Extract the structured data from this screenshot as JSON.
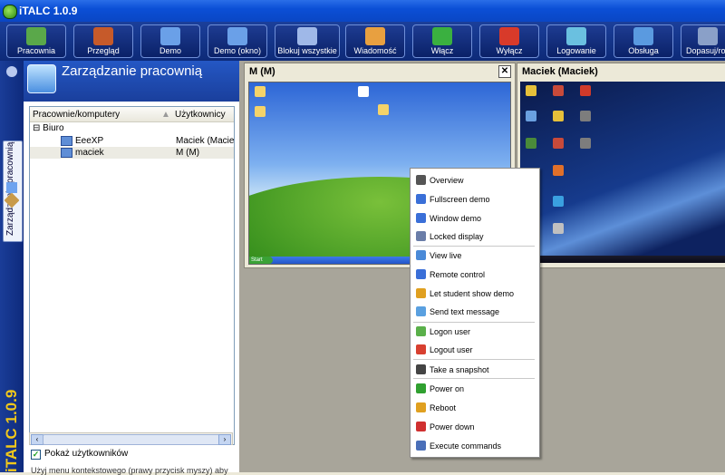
{
  "window": {
    "title": "iTALC 1.0.9"
  },
  "toolbar": {
    "buttons": [
      {
        "label": "Pracownia",
        "icon": "classroom-icon"
      },
      {
        "label": "Przegląd",
        "icon": "overview-icon"
      },
      {
        "label": "Demo",
        "icon": "demo-icon"
      },
      {
        "label": "Demo (okno)",
        "icon": "window-demo-icon"
      },
      {
        "label": "Blokuj wszystkie",
        "icon": "lock-icon"
      },
      {
        "label": "Wiadomość",
        "icon": "message-icon"
      },
      {
        "label": "Włącz",
        "icon": "power-on-icon"
      },
      {
        "label": "Wyłącz",
        "icon": "power-off-icon"
      },
      {
        "label": "Logowanie",
        "icon": "logon-icon"
      },
      {
        "label": "Obsługa",
        "icon": "support-icon"
      },
      {
        "label": "Dopasuj/roz",
        "icon": "fit-icon"
      }
    ]
  },
  "sidebar": {
    "tab_label": "Zarządzanie pracownią",
    "brand": "iTALC 1.0.9"
  },
  "panel": {
    "title": "Zarządzanie pracownią",
    "columns": [
      "Pracownie/komputery",
      "Użytkownicy"
    ],
    "group": {
      "label": "Biuro",
      "expander": "⊟"
    },
    "rows": [
      {
        "computer": "EeeXP",
        "user": "Maciek (Maciek)"
      },
      {
        "computer": "maciek",
        "user": "M (M)"
      }
    ],
    "show_users": {
      "label": "Pokaż użytkowników",
      "checked": true
    },
    "hint": "Użyj menu kontekstowego (prawy przycisk myszy) aby"
  },
  "screens": [
    {
      "title": "M (M)",
      "close": "✕",
      "start_label": "Start"
    },
    {
      "title": "Maciek (Maciek)"
    }
  ],
  "context_menu": {
    "items": [
      {
        "label": "Overview",
        "icon": "overview-icon",
        "color": "#555555"
      },
      {
        "label": "Fullscreen demo",
        "icon": "fullscreen-demo-icon",
        "color": "#3a6fd8"
      },
      {
        "label": "Window demo",
        "icon": "window-demo-icon",
        "color": "#3a6fd8"
      },
      {
        "label": "Locked display",
        "icon": "locked-display-icon",
        "color": "#6a7da8"
      },
      {
        "label": "View live",
        "icon": "view-live-icon",
        "color": "#4a8ad8"
      },
      {
        "label": "Remote control",
        "icon": "remote-control-icon",
        "color": "#3a6fd8"
      },
      {
        "label": "Let student show demo",
        "icon": "student-demo-icon",
        "color": "#e0a020"
      },
      {
        "label": "Send text message",
        "icon": "text-message-icon",
        "color": "#5aa0e0"
      },
      {
        "label": "Logon user",
        "icon": "logon-user-icon",
        "color": "#5ab04a"
      },
      {
        "label": "Logout user",
        "icon": "logout-user-icon",
        "color": "#d84030"
      },
      {
        "label": "Take a snapshot",
        "icon": "snapshot-icon",
        "color": "#444444"
      },
      {
        "label": "Power on",
        "icon": "power-on-icon",
        "color": "#30a030"
      },
      {
        "label": "Reboot",
        "icon": "reboot-icon",
        "color": "#e0a020"
      },
      {
        "label": "Power down",
        "icon": "power-down-icon",
        "color": "#d03030"
      },
      {
        "label": "Execute commands",
        "icon": "execute-commands-icon",
        "color": "#4a6fb8"
      }
    ]
  },
  "colors": {
    "toolbar": "#0d2a78",
    "panel_header": "#1a3f9c",
    "brand": "#f2c81a"
  }
}
